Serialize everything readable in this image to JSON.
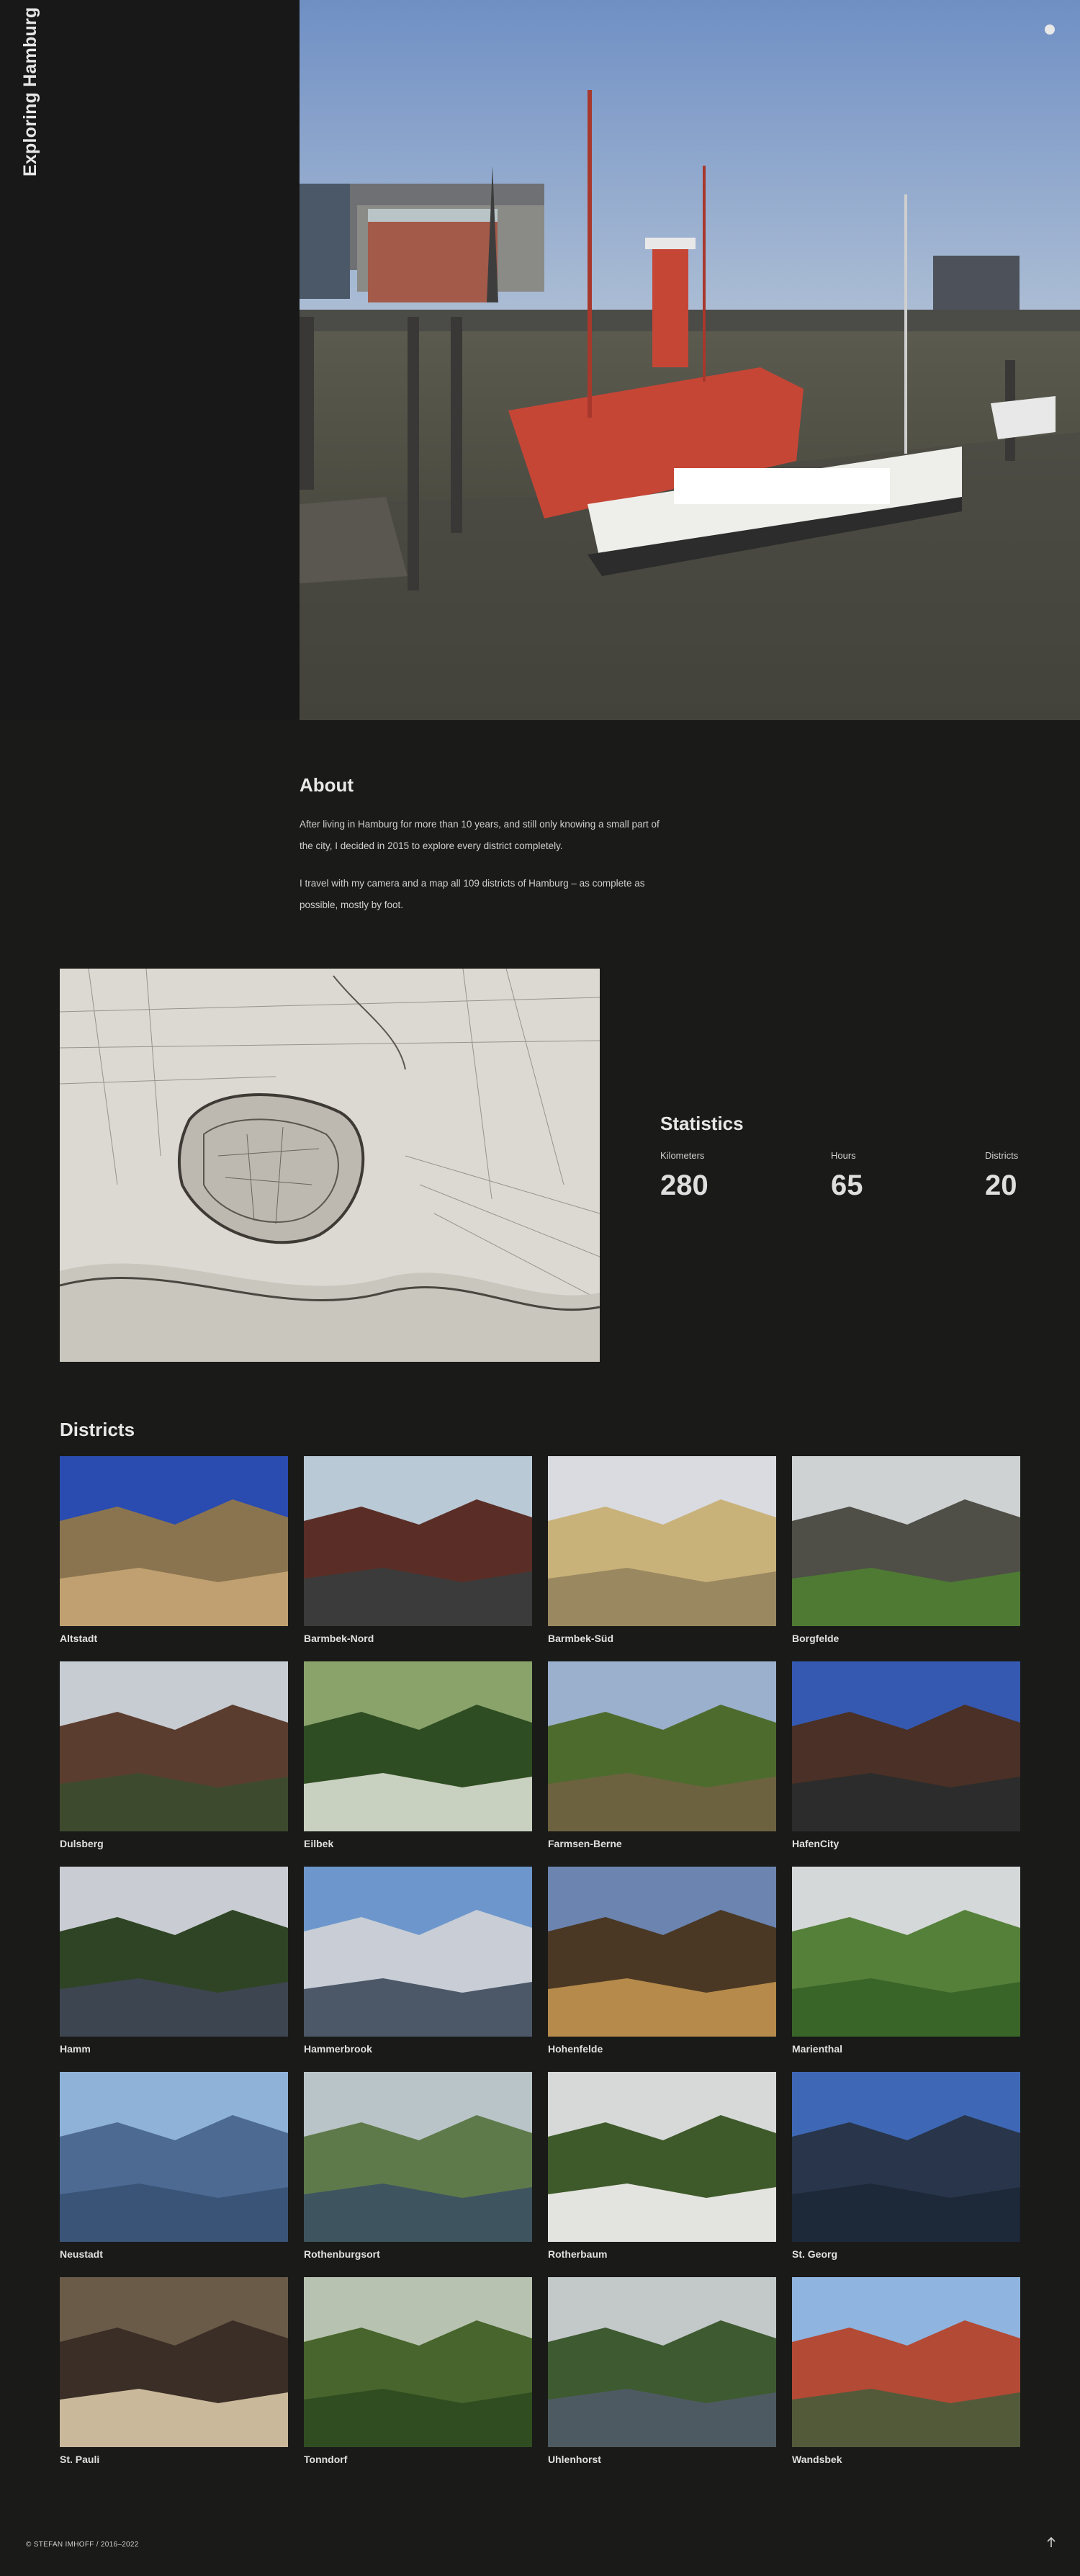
{
  "site": {
    "title": "Exploring Hamburg"
  },
  "about": {
    "heading": "About",
    "paragraphs": [
      "After living in Hamburg for more than 10 years, and still only knowing a small part of the city, I decided in 2015 to explore every district completely.",
      "I travel with my camera and a map all 109 districts of Hamburg – as complete as possible, mostly by foot."
    ]
  },
  "statistics": {
    "heading": "Statistics",
    "items": [
      {
        "label": "Kilometers",
        "value": "280"
      },
      {
        "label": "Hours",
        "value": "65"
      },
      {
        "label": "Districts",
        "value": "20"
      }
    ]
  },
  "districts": {
    "heading": "Districts",
    "items": [
      {
        "name": "Altstadt",
        "colors": [
          "#2a4bb0",
          "#8a7450",
          "#c0a070"
        ]
      },
      {
        "name": "Barmbek-Nord",
        "colors": [
          "#b9c9d6",
          "#5a2e26",
          "#3b3b3b"
        ]
      },
      {
        "name": "Barmbek-Süd",
        "colors": [
          "#d9dbe0",
          "#c9b27a",
          "#9a8860"
        ]
      },
      {
        "name": "Borgfelde",
        "colors": [
          "#cfd2d3",
          "#4f4e47",
          "#4e7a33"
        ]
      },
      {
        "name": "Dulsberg",
        "colors": [
          "#c6ccd2",
          "#5b3d30",
          "#3e4a2e"
        ]
      },
      {
        "name": "Eilbek",
        "colors": [
          "#8aa36b",
          "#2f4d22",
          "#c8d0c0"
        ]
      },
      {
        "name": "Farmsen-Berne",
        "colors": [
          "#9bb0cc",
          "#4e6b2e",
          "#6d6240"
        ]
      },
      {
        "name": "HafenCity",
        "colors": [
          "#3559b0",
          "#4a3026",
          "#2c2c2c"
        ]
      },
      {
        "name": "Hamm",
        "colors": [
          "#c9cdd3",
          "#2f4424",
          "#3d4550"
        ]
      },
      {
        "name": "Hammerbrook",
        "colors": [
          "#6d97cc",
          "#c8cdd6",
          "#4c5868"
        ]
      },
      {
        "name": "Hohenfelde",
        "colors": [
          "#6b84b0",
          "#4a3824",
          "#b58a4a"
        ]
      },
      {
        "name": "Marienthal",
        "colors": [
          "#d5d8d8",
          "#55803a",
          "#3a6528"
        ]
      },
      {
        "name": "Neustadt",
        "colors": [
          "#8fb2d8",
          "#4d6a92",
          "#3a5478"
        ]
      },
      {
        "name": "Rothenburgsort",
        "colors": [
          "#b9c4c8",
          "#5f7a4a",
          "#3e5560"
        ]
      },
      {
        "name": "Rotherbaum",
        "colors": [
          "#d7d9d9",
          "#3f5a2a",
          "#e3e3e0"
        ]
      },
      {
        "name": "St. Georg",
        "colors": [
          "#3e68b5",
          "#28354a",
          "#1d2838"
        ]
      },
      {
        "name": "St. Pauli",
        "colors": [
          "#6a5a48",
          "#3a2e26",
          "#c9b89a"
        ]
      },
      {
        "name": "Tonndorf",
        "colors": [
          "#b8c2b0",
          "#47652c",
          "#2f4d20"
        ]
      },
      {
        "name": "Uhlenhorst",
        "colors": [
          "#c3c8c9",
          "#3e5a30",
          "#4e5a62"
        ]
      },
      {
        "name": "Wandsbek",
        "colors": [
          "#8fb4df",
          "#b24a35",
          "#535a3a"
        ]
      }
    ]
  },
  "footer": {
    "copyright": "© STEFAN IMHOFF / 2016–2022"
  },
  "colors": {
    "background": "#1a1a19",
    "text": "#d9d9d9",
    "heading": "#e8e8e8"
  }
}
